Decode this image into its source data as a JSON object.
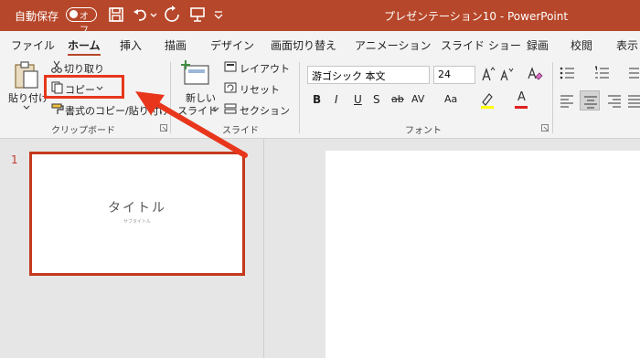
{
  "titlebar": {
    "autosave_label": "自動保存",
    "autosave_state": "オフ",
    "doc_title": "プレゼンテーション10  -  PowerPoint",
    "bg_color": "#b7472a"
  },
  "tabs": [
    "ファイル",
    "ホーム",
    "挿入",
    "描画",
    "デザイン",
    "画面切り替え",
    "アニメーション",
    "スライド ショー",
    "録画",
    "校閲",
    "表示"
  ],
  "active_tab": "ホーム",
  "clipboard": {
    "paste": "貼り付け",
    "cut": "切り取り",
    "copy": "コピー",
    "format_painter": "書式のコピー/貼り付け",
    "group_label": "クリップボード"
  },
  "slides_group": {
    "new_slide_line1": "新しい",
    "new_slide_line2": "スライド",
    "layout": "レイアウト",
    "reset": "リセット",
    "section": "セクション",
    "group_label": "スライド"
  },
  "font_group": {
    "font_name": "游ゴシック 本文",
    "font_size": "24",
    "bold": "B",
    "italic": "I",
    "underline": "U",
    "shadow": "S",
    "strike": "ab",
    "spacing": "AV",
    "case": "Aa",
    "font_color_glyph": "A",
    "group_label": "フォント"
  },
  "slide_panel": {
    "number": "1",
    "thumb_title": "タイトル",
    "thumb_subtitle": "サブタイトル"
  },
  "annotation": {
    "color": "#e8361c"
  }
}
